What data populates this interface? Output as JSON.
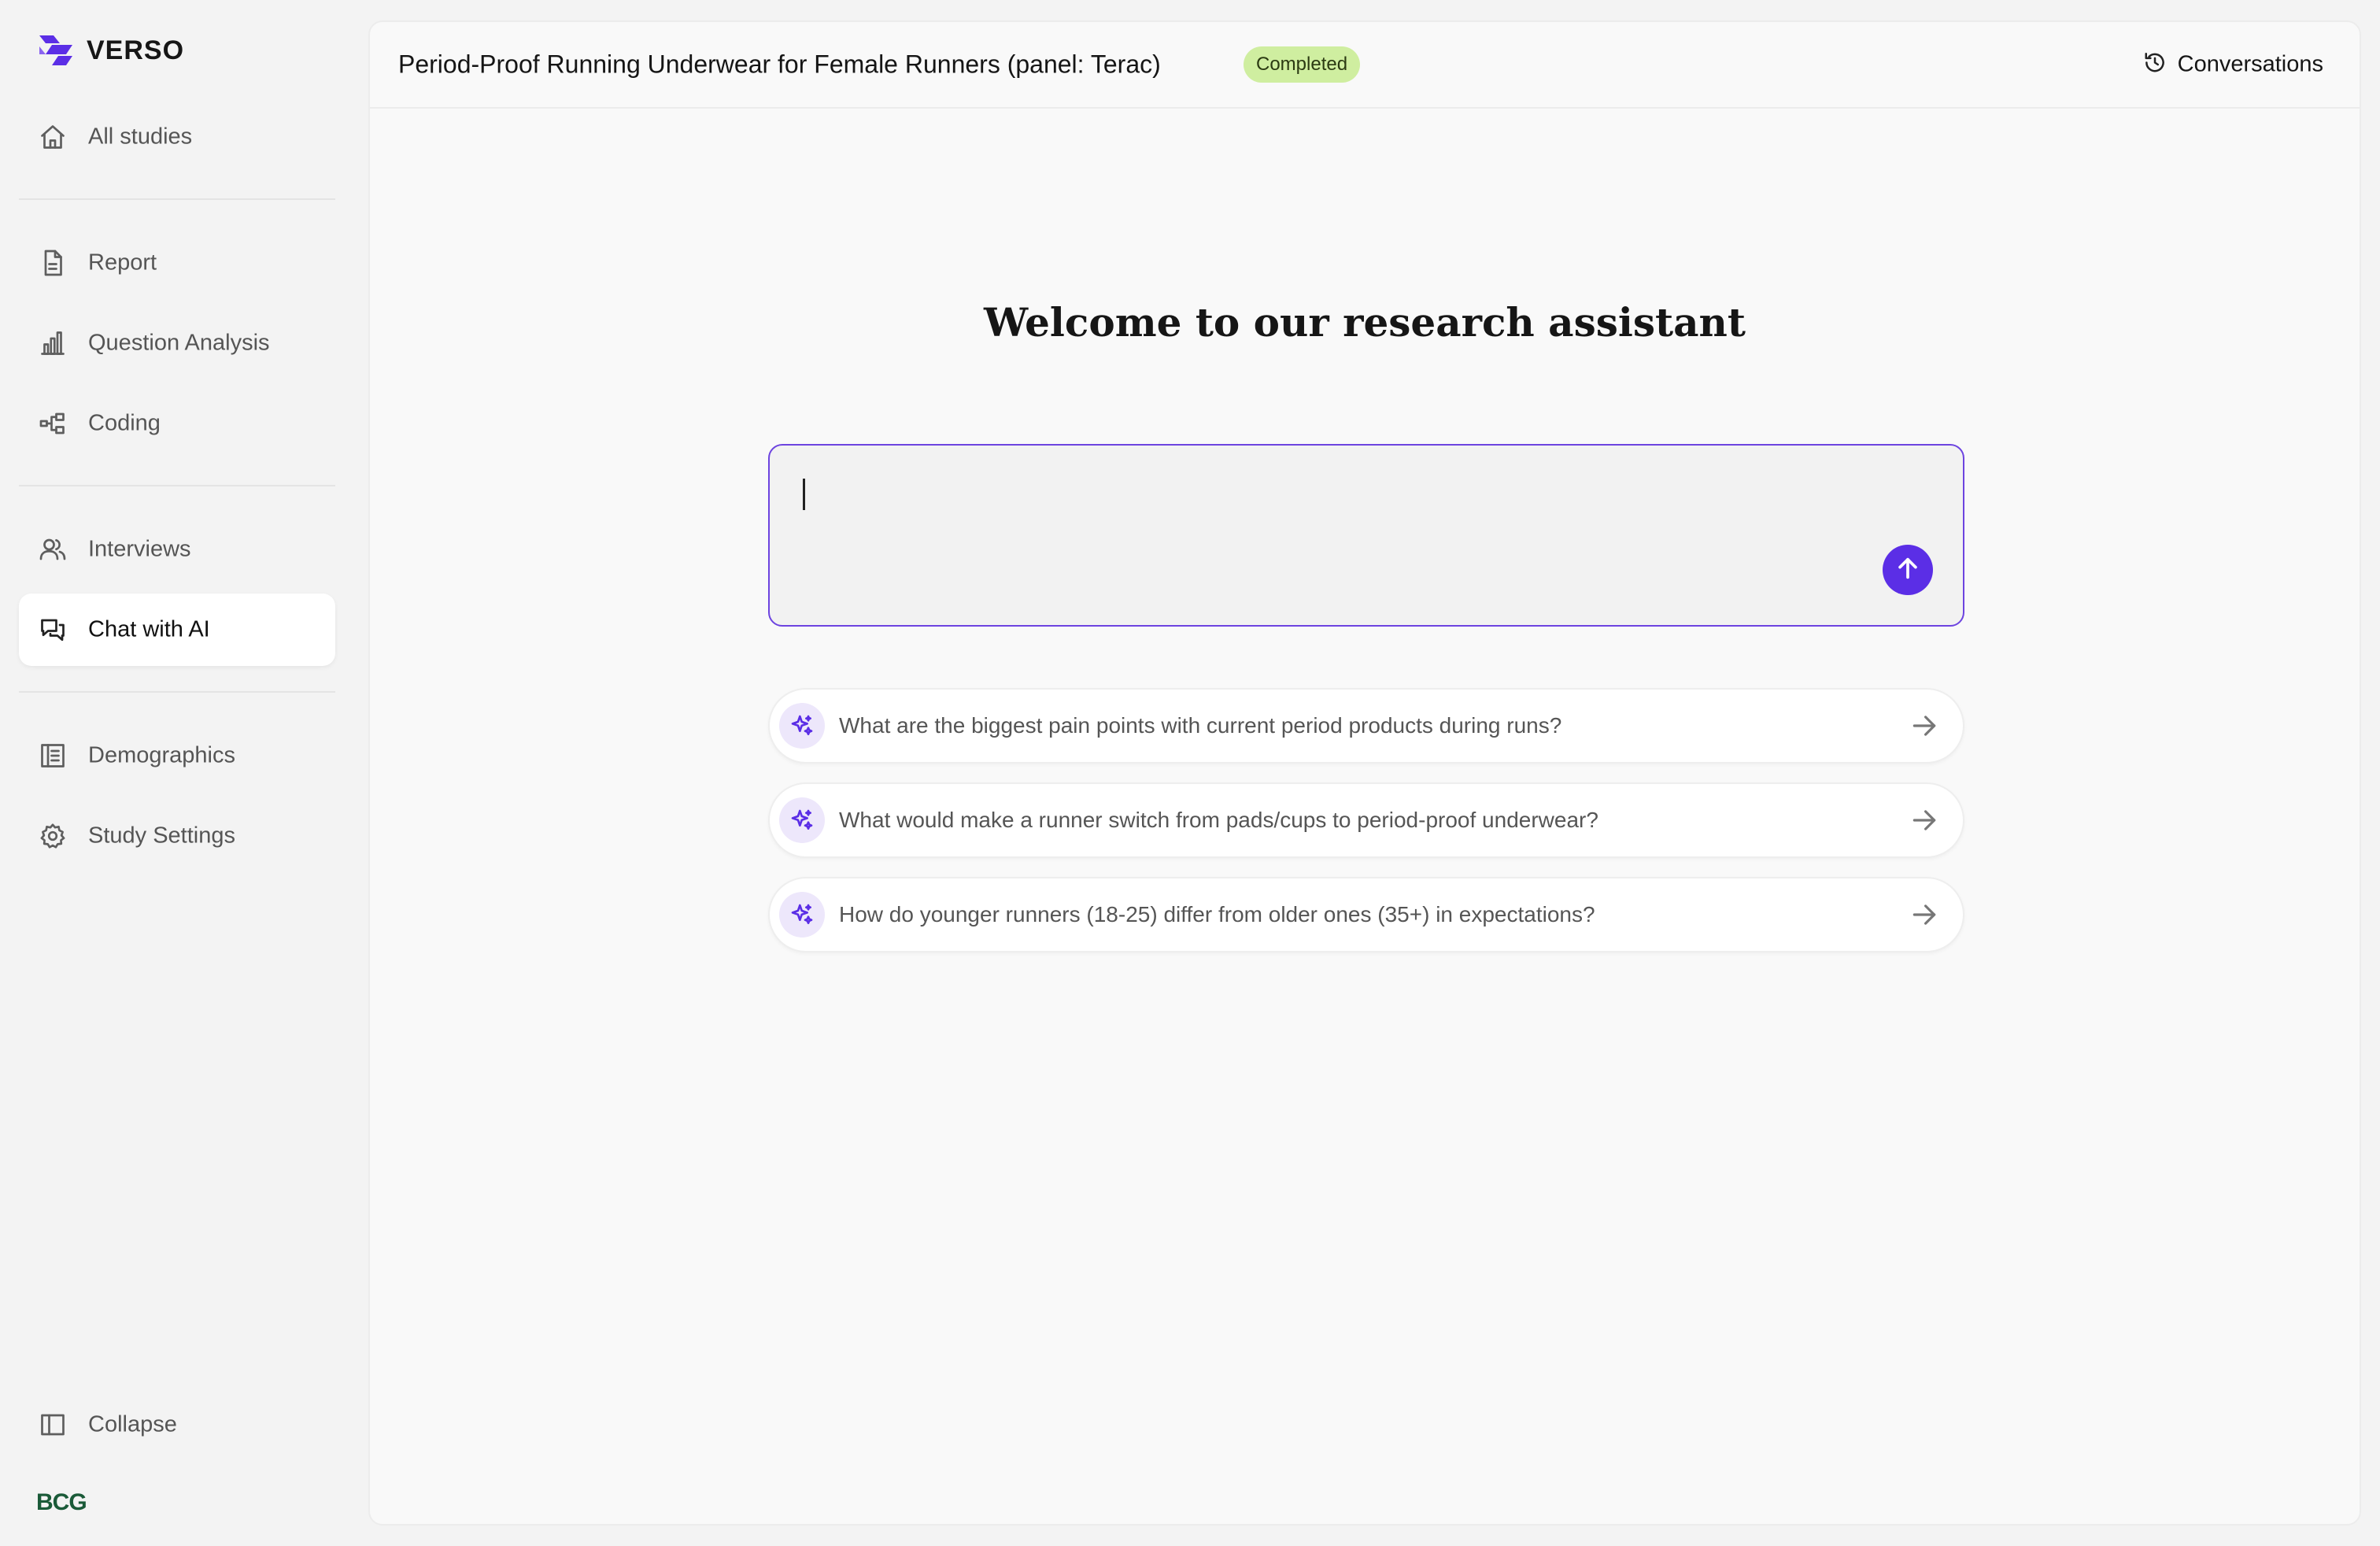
{
  "brand": {
    "name": "VERSO",
    "footer_logo": "BCG",
    "accent_color": "#5b2ee6"
  },
  "sidebar": {
    "items": [
      {
        "label": "All studies",
        "icon": "home-icon"
      },
      {
        "label": "Report",
        "icon": "document-icon"
      },
      {
        "label": "Question Analysis",
        "icon": "bar-chart-icon"
      },
      {
        "label": "Coding",
        "icon": "hierarchy-icon"
      },
      {
        "label": "Interviews",
        "icon": "users-icon"
      },
      {
        "label": "Chat with AI",
        "icon": "chat-icon",
        "active": true
      },
      {
        "label": "Demographics",
        "icon": "list-panel-icon"
      },
      {
        "label": "Study Settings",
        "icon": "gear-icon"
      }
    ],
    "collapse_label": "Collapse"
  },
  "header": {
    "title": "Period-Proof Running Underwear for Female Runners (panel: Terac)",
    "status": "Completed",
    "status_color": "#cfeea0",
    "conversations_label": "Conversations"
  },
  "assistant": {
    "welcome": "Welcome to our research assistant",
    "input_value": "",
    "suggestions": [
      "What are the biggest pain points with current period products during runs?",
      "What would make a runner switch from pads/cups to period-proof underwear?",
      "How do younger runners (18-25) differ from older ones (35+) in expectations?"
    ]
  }
}
